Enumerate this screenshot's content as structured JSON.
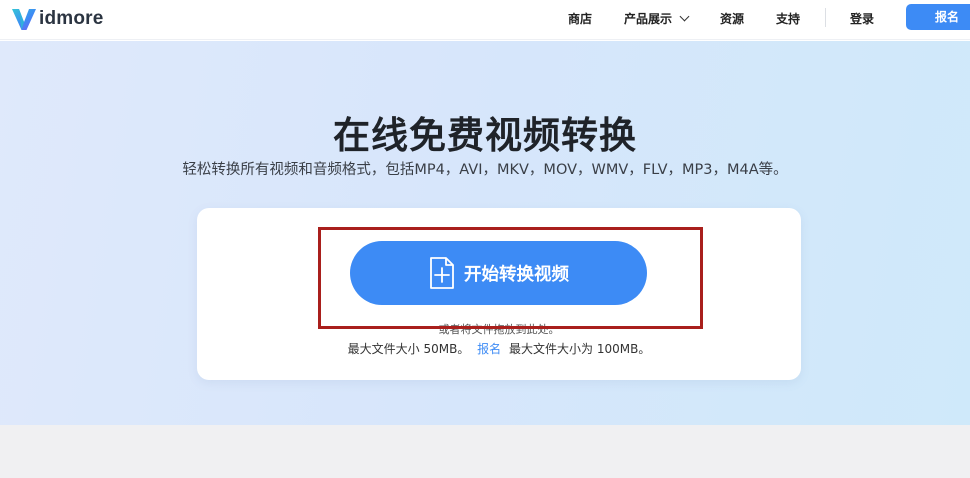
{
  "logo": {
    "text": "idmore"
  },
  "nav": {
    "store": "商店",
    "products": "产品展示",
    "resources": "资源",
    "support": "支持",
    "login": "登录",
    "signup": "报名"
  },
  "hero": {
    "title": "在线免费视频转换",
    "subtitle": "轻松转换所有视频和音频格式，包括MP4，AVI，MKV，MOV，WMV，FLV，MP3，M4A等。"
  },
  "upload": {
    "button_label": "开始转换视频",
    "drop_hint": "或者将文件拖放到此处。",
    "size_prefix": "最大文件大小 50MB。",
    "size_link": "报名",
    "size_suffix": "最大文件大小为 100MB。"
  },
  "colors": {
    "accent": "#3d8bf5",
    "highlight": "#a91f1c"
  }
}
